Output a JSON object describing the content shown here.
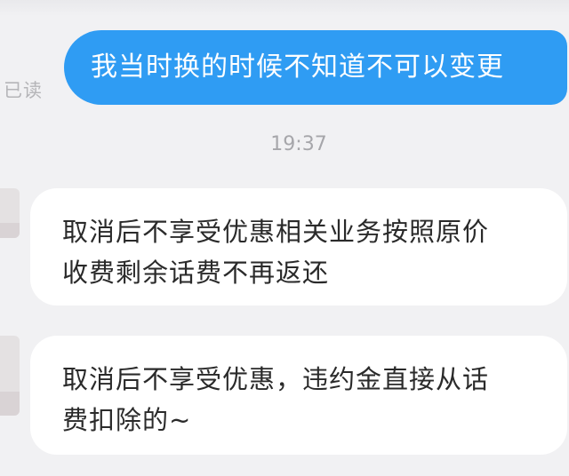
{
  "conversation": {
    "read_status": "已读",
    "timestamp": "19:37",
    "outgoing": [
      {
        "text": "我当时换的时候不知道不可以变更"
      }
    ],
    "incoming": [
      {
        "lines": [
          "取消后不享受优惠相关业务按照原价",
          "收费剩余话费不再返还"
        ]
      },
      {
        "lines": [
          "取消后不享受优惠，违约金直接从话",
          "费扣除的~"
        ]
      }
    ]
  },
  "colors": {
    "background": "#f1f1f3",
    "outgoing_bubble": "#2f9cf3",
    "incoming_bubble": "#ffffff",
    "meta_text": "#a6a6aa"
  }
}
